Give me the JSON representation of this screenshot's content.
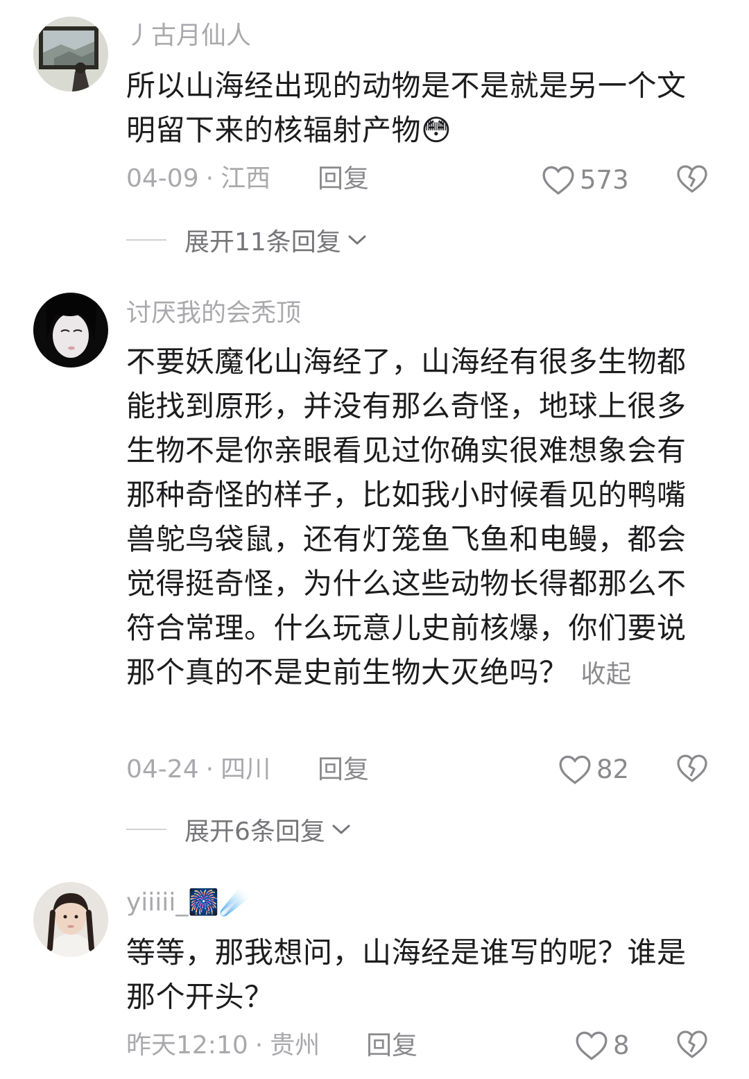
{
  "comments": [
    {
      "username": "丿古月仙人",
      "text": "所以山海经出现的动物是不是就是另一个文明留下来的核辐射产物",
      "emoji": "😳",
      "date": "04-09",
      "location": "江西",
      "reply_label": "回复",
      "likes": "573",
      "expand_label": "展开11条回复"
    },
    {
      "username": "讨厌我的会秃顶",
      "text": "不要妖魔化山海经了，山海经有很多生物都能找到原形，并没有那么奇怪，地球上很多生物不是你亲眼看见过你确实很难想象会有那种奇怪的样子，比如我小时候看见的鸭嘴兽鸵鸟袋鼠，还有灯笼鱼飞鱼和电鳗，都会觉得挺奇怪，为什么这些动物长得都那么不符合常理。什么玩意儿史前核爆，你们要说那个真的不是史前生物大灭绝吗？",
      "collapse_label": "收起",
      "date": "04-24",
      "location": "四川",
      "reply_label": "回复",
      "likes": "82",
      "expand_label": "展开6条回复"
    },
    {
      "username": "yiiiii_",
      "username_emojis": "🎆☄️",
      "text": "等等，那我想问，山海经是谁写的呢？谁是那个开头？",
      "date": "昨天12:10",
      "location": "贵州",
      "reply_label": "回复",
      "likes": "8"
    }
  ],
  "meta_separator": "·",
  "icons": {
    "like": "heart-outline-icon",
    "dislike": "broken-heart-icon",
    "expand": "chevron-down-icon"
  },
  "colors": {
    "text": "#1c1c1e",
    "secondary": "#a9a9ad",
    "background": "#ffffff"
  }
}
